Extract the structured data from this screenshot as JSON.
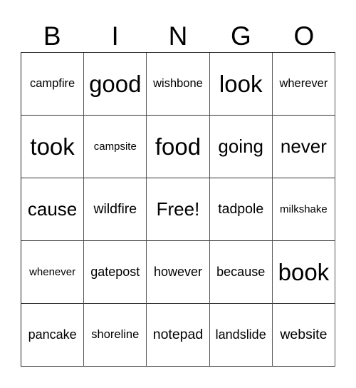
{
  "header": {
    "letters": [
      "B",
      "I",
      "N",
      "G",
      "O"
    ]
  },
  "cells": [
    {
      "text": "campfire",
      "size": "s1"
    },
    {
      "text": "good",
      "size": "s5"
    },
    {
      "text": "wishbone",
      "size": "s1"
    },
    {
      "text": "look",
      "size": "s5"
    },
    {
      "text": "wherever",
      "size": "s1"
    },
    {
      "text": "took",
      "size": "s5"
    },
    {
      "text": "campsite",
      "size": "s6"
    },
    {
      "text": "food",
      "size": "s5"
    },
    {
      "text": "going",
      "size": "s4"
    },
    {
      "text": "never",
      "size": "s4"
    },
    {
      "text": "cause",
      "size": "s4"
    },
    {
      "text": "wildfire",
      "size": "s3"
    },
    {
      "text": "Free!",
      "size": "s4"
    },
    {
      "text": "tadpole",
      "size": "s3"
    },
    {
      "text": "milkshake",
      "size": "s6"
    },
    {
      "text": "whenever",
      "size": "s6"
    },
    {
      "text": "gatepost",
      "size": "s2"
    },
    {
      "text": "however",
      "size": "s2"
    },
    {
      "text": "because",
      "size": "s2"
    },
    {
      "text": "book",
      "size": "s5"
    },
    {
      "text": "pancake",
      "size": "s2"
    },
    {
      "text": "shoreline",
      "size": "s1"
    },
    {
      "text": "notepad",
      "size": "s3"
    },
    {
      "text": "landslide",
      "size": "s2"
    },
    {
      "text": "website",
      "size": "s3"
    }
  ]
}
